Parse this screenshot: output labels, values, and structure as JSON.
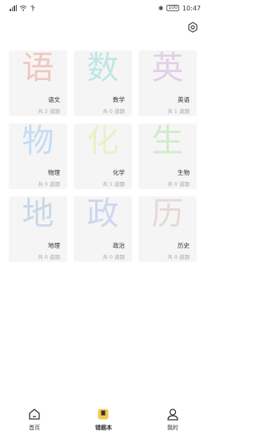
{
  "status_bar": {
    "left_text": "⁴ᴳ",
    "battery": "100",
    "time": "10:47"
  },
  "subjects": [
    {
      "glyph": "语",
      "name": "语文",
      "count": "共 2 道题",
      "color": "#f2c6c1"
    },
    {
      "glyph": "数",
      "name": "数学",
      "count": "共 0 道题",
      "color": "#bfe6e3"
    },
    {
      "glyph": "英",
      "name": "英语",
      "count": "共 1 道题",
      "color": "#e2cfe9"
    },
    {
      "glyph": "物",
      "name": "物理",
      "count": "共 0 道题",
      "color": "#c5dcf2"
    },
    {
      "glyph": "化",
      "name": "化学",
      "count": "共 1 道题",
      "color": "#ecefc9"
    },
    {
      "glyph": "生",
      "name": "生物",
      "count": "共 0 道题",
      "color": "#d0ecc9"
    },
    {
      "glyph": "地",
      "name": "地理",
      "count": "共 0 道题",
      "color": "#cad7e6"
    },
    {
      "glyph": "政",
      "name": "政治",
      "count": "共 0 道题",
      "color": "#cfd7ee"
    },
    {
      "glyph": "历",
      "name": "历史",
      "count": "共 0 道题",
      "color": "#e6d9d6"
    }
  ],
  "tabs": [
    {
      "label": "首页",
      "icon": "home-icon",
      "active": false
    },
    {
      "label": "错题本",
      "icon": "notebook-icon",
      "active": true
    },
    {
      "label": "我的",
      "icon": "user-icon",
      "active": false
    }
  ],
  "colors": {
    "card_bg": "#f5f5f5",
    "active_tab_icon": "#f2c94c"
  }
}
